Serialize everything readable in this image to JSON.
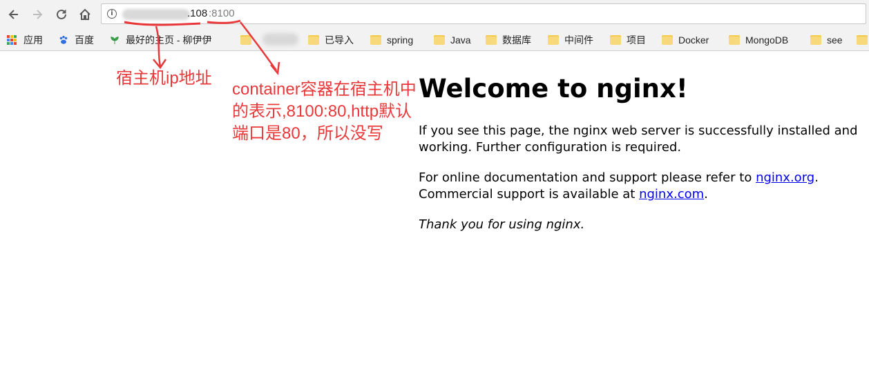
{
  "browser": {
    "url": {
      "host": ".108",
      "port": ":8100"
    }
  },
  "bookmarks": [
    {
      "label": "应用",
      "icon": "apps-grid-icon"
    },
    {
      "label": "百度",
      "icon": "baidu-paw-icon"
    },
    {
      "label": "最好的主页 - 柳伊伊",
      "icon": "leaf-icon"
    },
    {
      "label": "已导入",
      "icon": "folder-icon"
    },
    {
      "label": "spring",
      "icon": "folder-icon"
    },
    {
      "label": "Java",
      "icon": "folder-icon"
    },
    {
      "label": "数据库",
      "icon": "folder-icon"
    },
    {
      "label": "中间件",
      "icon": "folder-icon"
    },
    {
      "label": "项目",
      "icon": "folder-icon"
    },
    {
      "label": "Docker",
      "icon": "folder-icon"
    },
    {
      "label": "MongoDB",
      "icon": "folder-icon"
    },
    {
      "label": "see",
      "icon": "folder-icon"
    }
  ],
  "page": {
    "heading": "Welcome to nginx!",
    "para1": "If you see this page, the nginx web server is successfully installed and working. Further configuration is required.",
    "para2_prefix": "For online documentation and support please refer to ",
    "link1": "nginx.org",
    "para2_mid": ".",
    "para2_line2": "Commercial support is available at ",
    "link2": "nginx.com",
    "para2_end": ".",
    "para3": "Thank you for using nginx."
  },
  "annotations": {
    "left": "宿主机ip地址",
    "right": "container容器在宿主机中的表示,8100:80,http默认端口是80，所以没写"
  },
  "colors": {
    "annotation": "#e8383a",
    "link": "#0000ee",
    "folder": "#f7d87b"
  }
}
